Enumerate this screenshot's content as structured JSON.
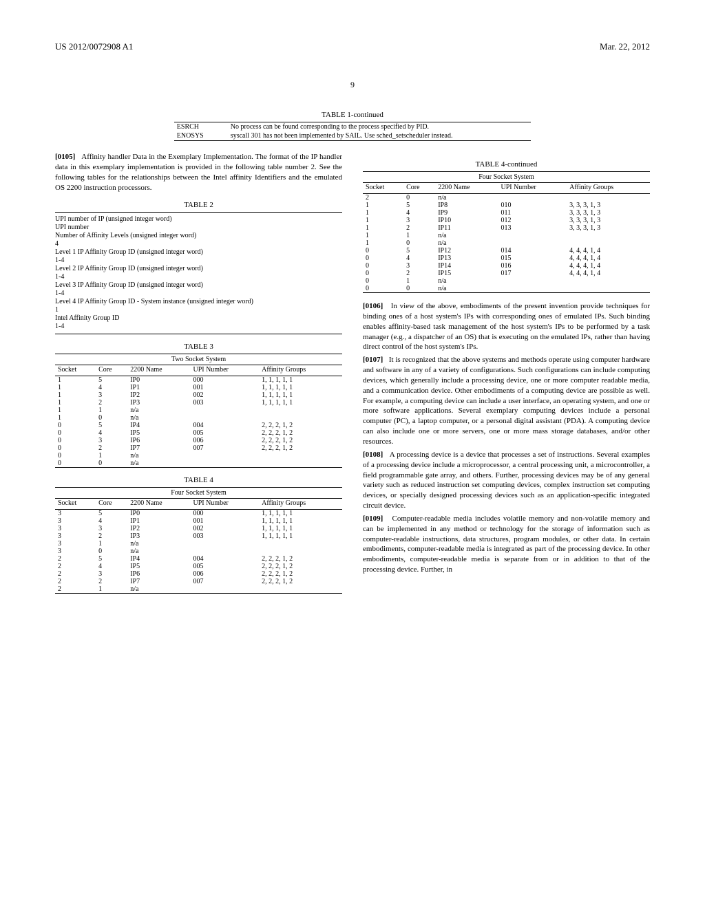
{
  "header": {
    "pub_number": "US 2012/0072908 A1",
    "pub_date": "Mar. 22, 2012"
  },
  "page_number": "9",
  "table1": {
    "title": "TABLE 1-continued",
    "rows": [
      {
        "code": "ESRCH",
        "desc": "No process can be found corresponding to the process specified by PID."
      },
      {
        "code": "ENOSYS",
        "desc": "syscall 301 has not been implemented by SAIL. Use sched_setscheduler instead."
      }
    ]
  },
  "para105": {
    "num": "[0105]",
    "text": "Affinity handler Data in the Exemplary Implementation. The format of the IP handler data in this exemplary implementation is provided in the following table number 2. See the following tables for the relationships between the Intel affinity Identifiers and the emulated OS 2200 instruction processors."
  },
  "table2": {
    "title": "TABLE 2",
    "lines": [
      "UPI number of IP (unsigned integer word)",
      "UPI number",
      "Number of Affinity Levels (unsigned integer word)",
      "4",
      "Level 1 IP Affinity Group ID (unsigned integer word)",
      "1-4",
      "Level 2 IP Affinity Group ID (unsigned integer word)",
      "1-4",
      "Level 3 IP Affinity Group ID (unsigned integer word)",
      "1-4",
      "Level 4 IP Affinity Group ID - System instance (unsigned integer word)",
      "1",
      "Intel Affinity Group ID",
      "1-4"
    ]
  },
  "table3": {
    "title": "TABLE 3",
    "subtitle": "Two Socket System",
    "headers": [
      "Socket",
      "Core",
      "2200 Name",
      "UPI Number",
      "Affinity Groups"
    ],
    "rows": [
      [
        "1",
        "5",
        "IP0",
        "000",
        "1, 1, 1, 1, 1"
      ],
      [
        "1",
        "4",
        "IP1",
        "001",
        "1, 1, 1, 1, 1"
      ],
      [
        "1",
        "3",
        "IP2",
        "002",
        "1, 1, 1, 1, 1"
      ],
      [
        "1",
        "2",
        "IP3",
        "003",
        "1, 1, 1, 1, 1"
      ],
      [
        "1",
        "1",
        "n/a",
        "",
        ""
      ],
      [
        "1",
        "0",
        "n/a",
        "",
        ""
      ],
      [
        "0",
        "5",
        "IP4",
        "004",
        "2, 2, 2, 1, 2"
      ],
      [
        "0",
        "4",
        "IP5",
        "005",
        "2, 2, 2, 1, 2"
      ],
      [
        "0",
        "3",
        "IP6",
        "006",
        "2, 2, 2, 1, 2"
      ],
      [
        "0",
        "2",
        "IP7",
        "007",
        "2, 2, 2, 1, 2"
      ],
      [
        "0",
        "1",
        "n/a",
        "",
        ""
      ],
      [
        "0",
        "0",
        "n/a",
        "",
        ""
      ]
    ]
  },
  "table4": {
    "title": "TABLE 4",
    "subtitle": "Four Socket System",
    "headers": [
      "Socket",
      "Core",
      "2200 Name",
      "UPI Number",
      "Affinity Groups"
    ],
    "rows": [
      [
        "3",
        "5",
        "IP0",
        "000",
        "1, 1, 1, 1, 1"
      ],
      [
        "3",
        "4",
        "IP1",
        "001",
        "1, 1, 1, 1, 1"
      ],
      [
        "3",
        "3",
        "IP2",
        "002",
        "1, 1, 1, 1, 1"
      ],
      [
        "3",
        "2",
        "IP3",
        "003",
        "1, 1, 1, 1, 1"
      ],
      [
        "3",
        "1",
        "n/a",
        "",
        ""
      ],
      [
        "3",
        "0",
        "n/a",
        "",
        ""
      ],
      [
        "2",
        "5",
        "IP4",
        "004",
        "2, 2, 2, 1, 2"
      ],
      [
        "2",
        "4",
        "IP5",
        "005",
        "2, 2, 2, 1, 2"
      ],
      [
        "2",
        "3",
        "IP6",
        "006",
        "2, 2, 2, 1, 2"
      ],
      [
        "2",
        "2",
        "IP7",
        "007",
        "2, 2, 2, 1, 2"
      ],
      [
        "2",
        "1",
        "n/a",
        "",
        ""
      ]
    ]
  },
  "table4c": {
    "title": "TABLE 4-continued",
    "subtitle": "Four Socket System",
    "headers": [
      "Socket",
      "Core",
      "2200 Name",
      "UPI Number",
      "Affinity Groups"
    ],
    "rows": [
      [
        "2",
        "0",
        "n/a",
        "",
        ""
      ],
      [
        "1",
        "5",
        "IP8",
        "010",
        "3, 3, 3, 1, 3"
      ],
      [
        "1",
        "4",
        "IP9",
        "011",
        "3, 3, 3, 1, 3"
      ],
      [
        "1",
        "3",
        "IP10",
        "012",
        "3, 3, 3, 1, 3"
      ],
      [
        "1",
        "2",
        "IP11",
        "013",
        "3, 3, 3, 1, 3"
      ],
      [
        "1",
        "1",
        "n/a",
        "",
        ""
      ],
      [
        "1",
        "0",
        "n/a",
        "",
        ""
      ],
      [
        "0",
        "5",
        "IP12",
        "014",
        "4, 4, 4, 1, 4"
      ],
      [
        "0",
        "4",
        "IP13",
        "015",
        "4, 4, 4, 1, 4"
      ],
      [
        "0",
        "3",
        "IP14",
        "016",
        "4, 4, 4, 1, 4"
      ],
      [
        "0",
        "2",
        "IP15",
        "017",
        "4, 4, 4, 1, 4"
      ],
      [
        "0",
        "1",
        "n/a",
        "",
        ""
      ],
      [
        "0",
        "0",
        "n/a",
        "",
        ""
      ]
    ]
  },
  "para106": {
    "num": "[0106]",
    "text": "In view of the above, embodiments of the present invention provide techniques for binding ones of a host system's IPs with corresponding ones of emulated IPs. Such binding enables affinity-based task management of the host system's IPs to be performed by a task manager (e.g., a dispatcher of an OS) that is executing on the emulated IPs, rather than having direct control of the host system's IPs."
  },
  "para107": {
    "num": "[0107]",
    "text": "It is recognized that the above systems and methods operate using computer hardware and software in any of a variety of configurations. Such configurations can include computing devices, which generally include a processing device, one or more computer readable media, and a communication device. Other embodiments of a computing device are possible as well. For example, a computing device can include a user interface, an operating system, and one or more software applications. Several exemplary computing devices include a personal computer (PC), a laptop computer, or a personal digital assistant (PDA). A computing device can also include one or more servers, one or more mass storage databases, and/or other resources."
  },
  "para108": {
    "num": "[0108]",
    "text": "A processing device is a device that processes a set of instructions. Several examples of a processing device include a microprocessor, a central processing unit, a microcontroller, a field programmable gate array, and others. Further, processing devices may be of any general variety such as reduced instruction set computing devices, complex instruction set computing devices, or specially designed processing devices such as an application-specific integrated circuit device."
  },
  "para109": {
    "num": "[0109]",
    "text": "Computer-readable media includes volatile memory and non-volatile memory and can be implemented in any method or technology for the storage of information such as computer-readable instructions, data structures, program modules, or other data. In certain embodiments, computer-readable media is integrated as part of the processing device. In other embodiments, computer-readable media is separate from or in addition to that of the processing device. Further, in"
  }
}
